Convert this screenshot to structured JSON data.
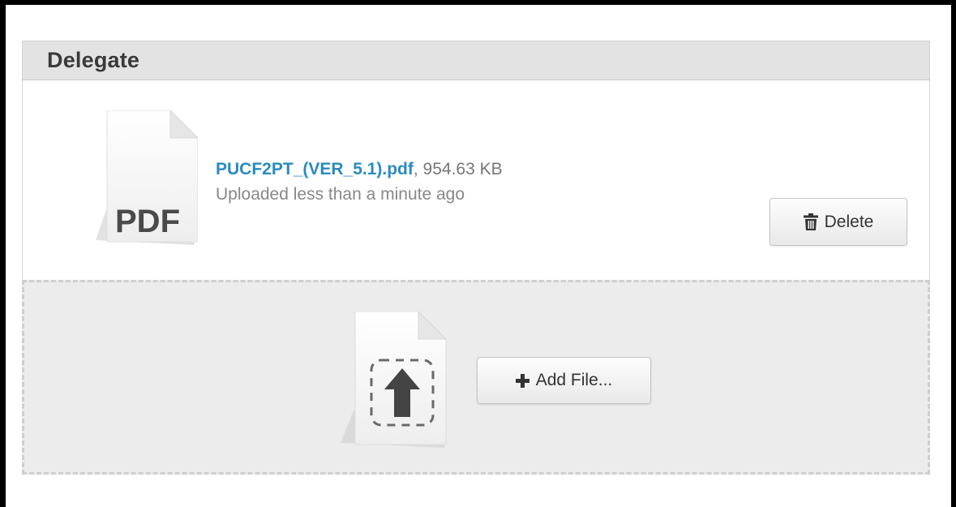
{
  "panel": {
    "title": "Delegate"
  },
  "file": {
    "icon_label": "PDF",
    "name": "PUCF2PT_(VER_5.1).pdf",
    "size_text": ", 954.63 KB",
    "status": "Uploaded less than a minute ago"
  },
  "actions": {
    "delete_label": "Delete",
    "delete_icon": "trash-icon",
    "add_label": "Add File...",
    "add_icon": "plus-icon"
  },
  "dropzone": {
    "icon": "upload-icon"
  },
  "colors": {
    "header_bg": "#e3e3e3",
    "link": "#2a8bbf",
    "dropzone_bg": "#ececec"
  }
}
